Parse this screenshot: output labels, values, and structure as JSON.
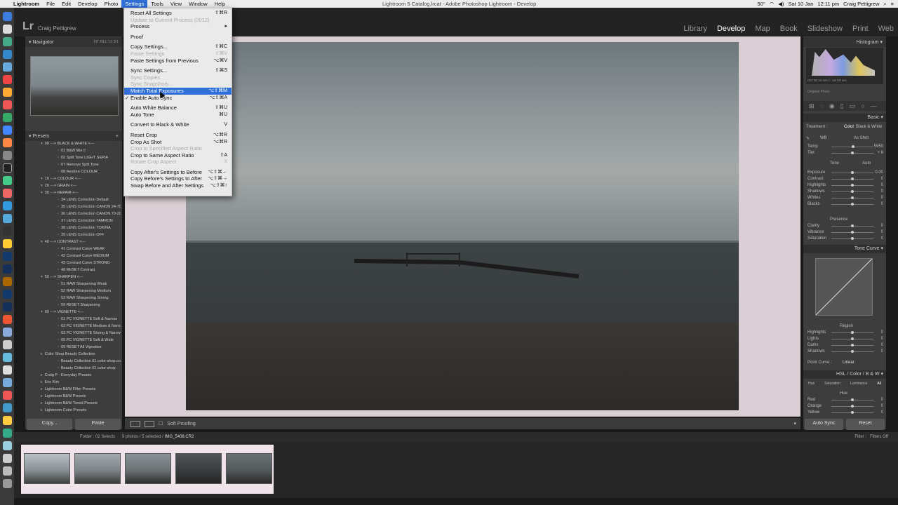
{
  "menubar": {
    "items": [
      "Lightroom",
      "File",
      "Edit",
      "Develop",
      "Photo",
      "Settings",
      "Tools",
      "View",
      "Window",
      "Help"
    ],
    "window_title": "Lightroom 5 Catalog.lrcat - Adobe Photoshop Lightroom - Develop",
    "date": "Sat 10 Jan",
    "time": "12:11 pm",
    "user": "Craig Pettigrew",
    "wifi_label": "50°"
  },
  "identity": {
    "logo": "Lr",
    "user": "Craig Pettigrew"
  },
  "modules": [
    "Library",
    "Develop",
    "Map",
    "Book",
    "Slideshow",
    "Print",
    "Web"
  ],
  "left": {
    "navigator_title": "Navigator",
    "navigator_zoom": "FIT  FILL  1:1  3:1",
    "presets_title": "Presets",
    "presets": [
      {
        "t": "00 ---> BLACK & WHITE <---",
        "k": "folder"
      },
      {
        "t": "01 B&W Mix 0",
        "k": "item"
      },
      {
        "t": "02 Split Tone LIGHT SEPIA",
        "k": "item"
      },
      {
        "t": "07 Remove Split Tone",
        "k": "item"
      },
      {
        "t": "08 Restore COLOUR",
        "k": "item"
      },
      {
        "t": "10 ---> COLOUR <---",
        "k": "folder"
      },
      {
        "t": "20 ---> GRAIN <---",
        "k": "folder"
      },
      {
        "t": "30 ---> REPAIR <---",
        "k": "folder"
      },
      {
        "t": "34 LENS Correction Default",
        "k": "item"
      },
      {
        "t": "35 LENS Correction CANON 24-70",
        "k": "item"
      },
      {
        "t": "36 LENS Correction CANON 70-200",
        "k": "item"
      },
      {
        "t": "37 LENS Correction TAMRON",
        "k": "item"
      },
      {
        "t": "38 LENS Correction TOKINA",
        "k": "item"
      },
      {
        "t": "39 LENS Correction OFF",
        "k": "item"
      },
      {
        "t": "40 ---> CONTRAST <---",
        "k": "folder"
      },
      {
        "t": "41 Contrast Curve WEAK",
        "k": "item"
      },
      {
        "t": "42 Contrast Curve MEDIUM",
        "k": "item"
      },
      {
        "t": "43 Contrast Curve STRONG",
        "k": "item"
      },
      {
        "t": "48 RESET Contrast",
        "k": "item"
      },
      {
        "t": "50 ---> SHARPEN <---",
        "k": "folder"
      },
      {
        "t": "51 RAW Sharpening Weak",
        "k": "item"
      },
      {
        "t": "52 RAW Sharpening Medium",
        "k": "item"
      },
      {
        "t": "53 RAW Sharpening Strong",
        "k": "item"
      },
      {
        "t": "59 RESET Sharpening",
        "k": "item"
      },
      {
        "t": "60 ---> VIGNETTE <---",
        "k": "folder"
      },
      {
        "t": "61 PC VIGNETTE Soft & Narrow",
        "k": "item"
      },
      {
        "t": "62 PC VIGNETTE Medium & Narrow",
        "k": "item"
      },
      {
        "t": "63 PC VIGNETTE Strong & Narrow",
        "k": "item"
      },
      {
        "t": "65 PC VIGNETTE Soft & Wide",
        "k": "item"
      },
      {
        "t": "69 RESET All Vignettes",
        "k": "item"
      },
      {
        "t": "Color Shop Beauty Collection",
        "k": "top"
      },
      {
        "t": "Beauty Collection 01 color-shop.co",
        "k": "item"
      },
      {
        "t": "Beauty Collection 01 color-shop",
        "k": "item"
      },
      {
        "t": "Craig P - Everyday Presets",
        "k": "top"
      },
      {
        "t": "Eric Kim",
        "k": "top"
      },
      {
        "t": "Lightroom B&W Filter Presets",
        "k": "top"
      },
      {
        "t": "Lightroom B&W Presets",
        "k": "top"
      },
      {
        "t": "Lightroom B&W Toned Presets",
        "k": "top"
      },
      {
        "t": "Lightroom Color Presets",
        "k": "top"
      }
    ],
    "copy_btn": "Copy...",
    "paste_btn": "Paste"
  },
  "toolbar": {
    "soft_proofing": "Soft Proofing"
  },
  "right": {
    "histogram_title": "Histogram",
    "hist_readout": "ISO 50    24 mm    f / 16    1/8 sec",
    "original_photo": "Original Photo",
    "basic_title": "Basic",
    "treatment_label": "Treatment :",
    "treatment_color": "Color",
    "treatment_bw": "Black & White",
    "wb_label": "WB :",
    "wb_value": "As Shot",
    "tone_label": "Tone",
    "auto_label": "Auto",
    "presence_label": "Presence",
    "sliders": [
      {
        "label": "Temp",
        "value": "5950",
        "pos": 0.52
      },
      {
        "label": "Tint",
        "value": "+ 6",
        "pos": 0.5
      },
      {
        "label": "Exposure",
        "value": "0.00",
        "pos": 0.5
      },
      {
        "label": "Contrast",
        "value": "0",
        "pos": 0.5
      },
      {
        "label": "Highlights",
        "value": "0",
        "pos": 0.5
      },
      {
        "label": "Shadows",
        "value": "0",
        "pos": 0.5
      },
      {
        "label": "Whites",
        "value": "0",
        "pos": 0.5
      },
      {
        "label": "Blacks",
        "value": "0",
        "pos": 0.5
      },
      {
        "label": "Clarity",
        "value": "0",
        "pos": 0.5
      },
      {
        "label": "Vibrance",
        "value": "0",
        "pos": 0.5
      },
      {
        "label": "Saturation",
        "value": "0",
        "pos": 0.5
      }
    ],
    "tonecurve_title": "Tone Curve",
    "region_label": "Region",
    "region_sliders": [
      {
        "label": "Highlights",
        "value": "0",
        "pos": 0.5
      },
      {
        "label": "Lights",
        "value": "0",
        "pos": 0.5
      },
      {
        "label": "Darks",
        "value": "0",
        "pos": 0.5
      },
      {
        "label": "Shadows",
        "value": "0",
        "pos": 0.5
      }
    ],
    "point_curve_label": "Point Curve :",
    "point_curve_value": "Linear",
    "hsl_title": "HSL  /  Color  /  B & W",
    "hsl_tabs": [
      "Hue",
      "Saturation",
      "Luminance",
      "All"
    ],
    "hue_label": "Hue",
    "hue_sliders": [
      {
        "label": "Red",
        "value": "0",
        "pos": 0.5
      },
      {
        "label": "Orange",
        "value": "0",
        "pos": 0.5
      },
      {
        "label": "Yellow",
        "value": "0",
        "pos": 0.5
      }
    ],
    "autosync_btn": "Auto Sync",
    "reset_btn": "Reset"
  },
  "filmbar": {
    "folder": "Folder : 02 Selects",
    "selection": "5 photos / 5 selected /",
    "filename": "IMG_5408.CR2",
    "filter_label": "Filter :",
    "filters_off": "Filters Off"
  },
  "menu": {
    "items": [
      {
        "label": "Reset All Settings",
        "sc": "⇧⌘R"
      },
      {
        "label": "Update to Current Process (2012)",
        "sc": "",
        "dis": true
      },
      {
        "label": "Process",
        "sc": "▸"
      },
      {
        "sep": true
      },
      {
        "label": "Proof",
        "sc": ""
      },
      {
        "sep": true
      },
      {
        "label": "Copy Settings...",
        "sc": "⇧⌘C"
      },
      {
        "label": "Paste Settings",
        "sc": "⇧⌘V",
        "dis": true
      },
      {
        "label": "Paste Settings from Previous",
        "sc": "⌥⌘V"
      },
      {
        "sep": true
      },
      {
        "label": "Sync Settings...",
        "sc": "⇧⌘S"
      },
      {
        "label": "Sync Copies",
        "sc": "",
        "dis": true
      },
      {
        "label": "Sync Snapshots...",
        "sc": "",
        "dis": true
      },
      {
        "label": "Match Total Exposures",
        "sc": "⌥⇧⌘M",
        "hi": true
      },
      {
        "label": "Enable Auto Sync",
        "sc": "⌥⇧⌘A",
        "check": true
      },
      {
        "sep": true
      },
      {
        "label": "Auto White Balance",
        "sc": "⇧⌘U"
      },
      {
        "label": "Auto Tone",
        "sc": "⌘U"
      },
      {
        "sep": true
      },
      {
        "label": "Convert to Black & White",
        "sc": "V"
      },
      {
        "sep": true
      },
      {
        "label": "Reset Crop",
        "sc": "⌥⌘R"
      },
      {
        "label": "Crop As Shot",
        "sc": "⌥⌘R"
      },
      {
        "label": "Crop to Specified Aspect Ratio",
        "sc": "",
        "dis": true
      },
      {
        "label": "Crop to Same Aspect Ratio",
        "sc": "⇧A"
      },
      {
        "label": "Rotate Crop Aspect",
        "sc": "X",
        "dis": true
      },
      {
        "sep": true
      },
      {
        "label": "Copy After's Settings to Before",
        "sc": "⌥⇧⌘←"
      },
      {
        "label": "Copy Before's Settings to After",
        "sc": "⌥⇧⌘→"
      },
      {
        "label": "Swap Before and After Settings",
        "sc": "⌥⇧⌘↑"
      }
    ]
  },
  "colors": {
    "accent": "#2f6fd6",
    "panel": "#3d3d3d",
    "background": "#1a1a1a"
  }
}
